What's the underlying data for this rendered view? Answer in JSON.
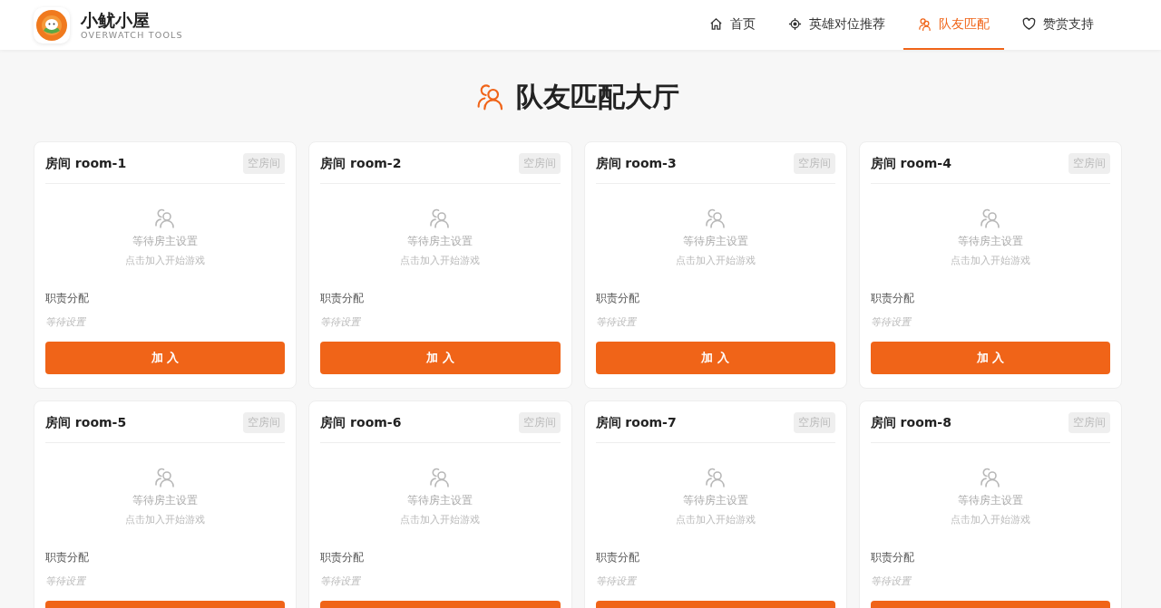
{
  "header": {
    "brand": "小鱿小屋",
    "tagline": "OVERWATCH TOOLS",
    "nav": [
      {
        "label": "首页",
        "kind": "home",
        "selected": false
      },
      {
        "label": "英雄对位推荐",
        "kind": "target",
        "selected": false
      },
      {
        "label": "队友匹配",
        "kind": "users",
        "selected": true
      },
      {
        "label": "赞赏支持",
        "kind": "heart",
        "selected": false
      }
    ]
  },
  "title": "队友匹配大厅",
  "rooms": [
    {
      "name": "房间 room-1",
      "status": "空房间",
      "waiting": "等待房主设置",
      "hint": "点击加入开始游戏",
      "roles_label": "职责分配",
      "roles_value": "等待设置",
      "button": "加 入"
    },
    {
      "name": "房间 room-2",
      "status": "空房间",
      "waiting": "等待房主设置",
      "hint": "点击加入开始游戏",
      "roles_label": "职责分配",
      "roles_value": "等待设置",
      "button": "加 入"
    },
    {
      "name": "房间 room-3",
      "status": "空房间",
      "waiting": "等待房主设置",
      "hint": "点击加入开始游戏",
      "roles_label": "职责分配",
      "roles_value": "等待设置",
      "button": "加 入"
    },
    {
      "name": "房间 room-4",
      "status": "空房间",
      "waiting": "等待房主设置",
      "hint": "点击加入开始游戏",
      "roles_label": "职责分配",
      "roles_value": "等待设置",
      "button": "加 入"
    },
    {
      "name": "房间 room-5",
      "status": "空房间",
      "waiting": "等待房主设置",
      "hint": "点击加入开始游戏",
      "roles_label": "职责分配",
      "roles_value": "等待设置"
    },
    {
      "name": "房间 room-6",
      "status": "空房间",
      "waiting": "等待房主设置",
      "hint": "点击加入开始游戏",
      "roles_label": "职责分配",
      "roles_value": "等待设置"
    },
    {
      "name": "房间 room-7",
      "status": "空房间",
      "waiting": "等待房主设置",
      "hint": "点击加入开始游戏",
      "roles_label": "职责分配",
      "roles_value": "等待设置"
    },
    {
      "name": "房间 room-8",
      "status": "空房间",
      "waiting": "等待房主设置",
      "hint": "点击加入开始游戏",
      "roles_label": "职责分配",
      "roles_value": "等待设置"
    }
  ]
}
